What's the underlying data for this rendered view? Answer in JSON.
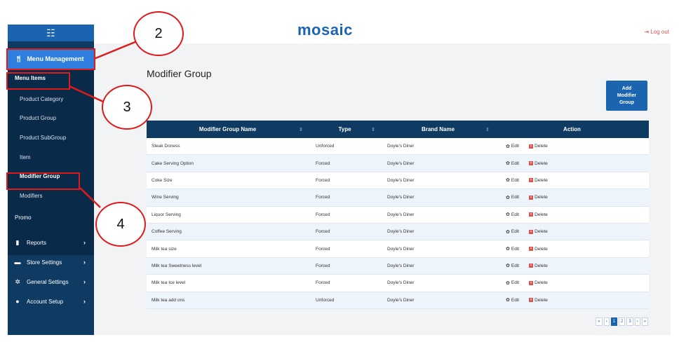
{
  "header": {
    "logo": "mosaic",
    "logout": "Log out"
  },
  "sidebar": {
    "hamburger_icon": "list-icon",
    "active_item": "Menu Management",
    "sub_items": [
      {
        "label": "Menu Items",
        "bold": true
      },
      {
        "label": "Product Category",
        "bold": false
      },
      {
        "label": "Product Group",
        "bold": false
      },
      {
        "label": "Product SubGroup",
        "bold": false
      },
      {
        "label": "Item",
        "bold": false
      },
      {
        "label": "Modifier Group",
        "bold": true
      },
      {
        "label": "Modifiers",
        "bold": false
      }
    ],
    "promo": "Promo",
    "main_items": [
      {
        "label": "Reports",
        "icon": "file-icon"
      },
      {
        "label": "Store Settings",
        "icon": "store-icon"
      },
      {
        "label": "General Settings",
        "icon": "gear-icon"
      },
      {
        "label": "Account Setup",
        "icon": "user-icon"
      }
    ]
  },
  "main": {
    "title": "Modifier Group",
    "add_button": "Add\nModifier\nGroup",
    "table": {
      "headers": [
        "Modifier Group Name",
        "Type",
        "Brand Name",
        "Action"
      ],
      "rows": [
        [
          "Steak Doness",
          "Unforced",
          "Doyle's Diner"
        ],
        [
          "Cake Serving Option",
          "Forced",
          "Doyle's Diner"
        ],
        [
          "Coke Size",
          "Forced",
          "Doyle's Diner"
        ],
        [
          "Wine Serving",
          "Forced",
          "Doyle's Diner"
        ],
        [
          "Liquor Serving",
          "Forced",
          "Doyle's Diner"
        ],
        [
          "Coffee Serving",
          "Forced",
          "Doyle's Diner"
        ],
        [
          "Milk tea size",
          "Forced",
          "Doyle's Diner"
        ],
        [
          "Milk tea Sweetness level",
          "Forced",
          "Doyle's Diner"
        ],
        [
          "Milk tea Ice level",
          "Forced",
          "Doyle's Diner"
        ],
        [
          "Milk tea add ons",
          "Unforced",
          "Doyle's Diner"
        ]
      ],
      "edit_label": "Edit",
      "delete_label": "Delete"
    },
    "pagination": [
      "«",
      "‹",
      "1",
      "2",
      "3",
      "›",
      "»"
    ],
    "current_page": "1"
  },
  "annotations": [
    "2",
    "3",
    "4"
  ],
  "colors": {
    "accent": "#1b64b0",
    "sidebar": "#0f3b63",
    "annotation": "#e01919"
  }
}
